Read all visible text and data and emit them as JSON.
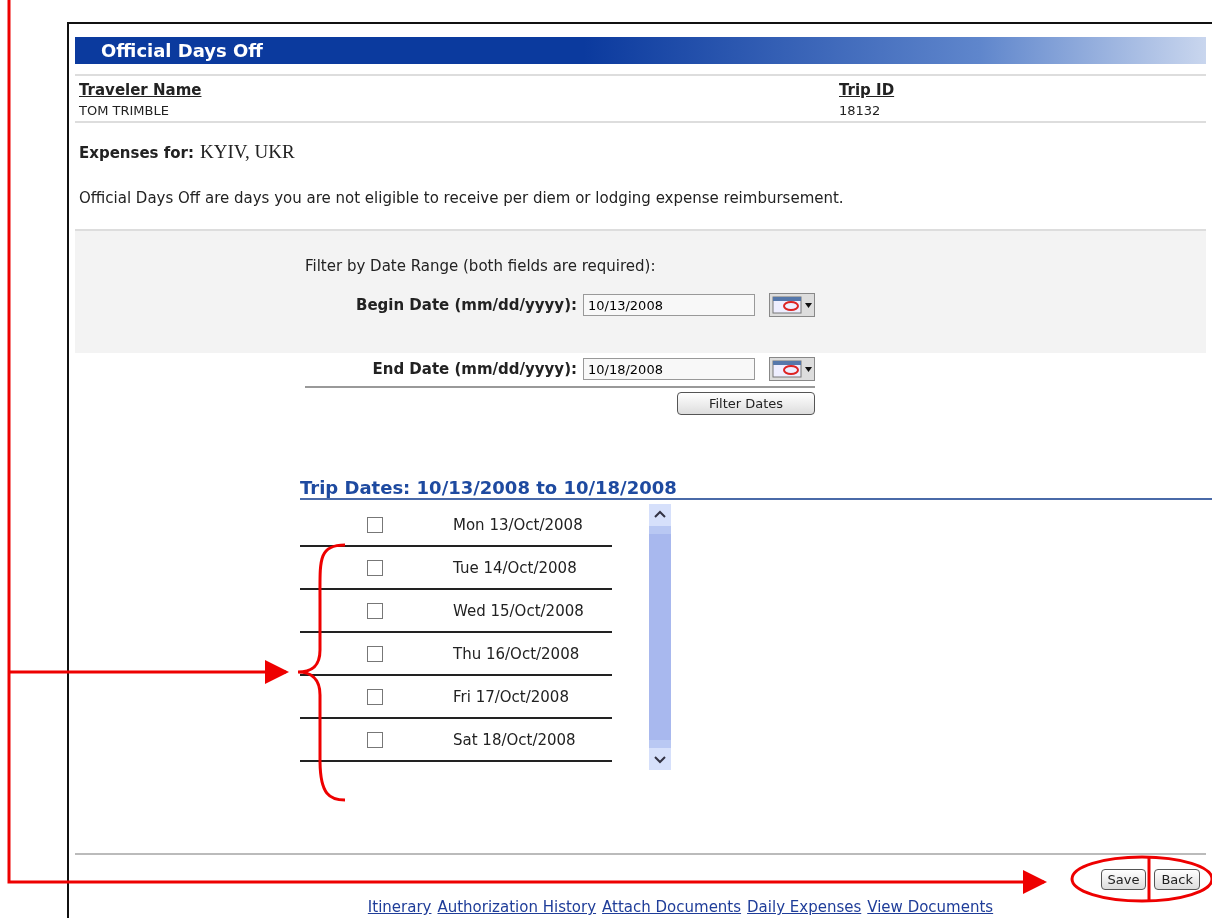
{
  "panel": {
    "title": "Official Days Off"
  },
  "traveler": {
    "label": "Traveler Name",
    "value": "TOM TRIMBLE"
  },
  "trip": {
    "label": "Trip ID",
    "value": "18132"
  },
  "expenses": {
    "label": "Expenses for:",
    "value": "KYIV, UKR"
  },
  "note": "Official Days Off are days you are not eligible to receive per diem or lodging expense reimbursement.",
  "filter": {
    "heading": "Filter by Date Range (both fields are required):",
    "fields": [
      {
        "label": "Begin Date (mm/dd/yyyy):",
        "value": "10/13/2008"
      },
      {
        "label": "End Date (mm/dd/yyyy):",
        "value": "10/18/2008"
      }
    ],
    "button": "Filter Dates"
  },
  "trip_dates": {
    "heading": "Trip Dates: 10/13/2008 to 10/18/2008",
    "rows": [
      {
        "date": "Mon 13/Oct/2008",
        "checked": false
      },
      {
        "date": "Tue 14/Oct/2008",
        "checked": false
      },
      {
        "date": "Wed 15/Oct/2008",
        "checked": false
      },
      {
        "date": "Thu 16/Oct/2008",
        "checked": false
      },
      {
        "date": "Fri 17/Oct/2008",
        "checked": false
      },
      {
        "date": "Sat 18/Oct/2008",
        "checked": false
      }
    ]
  },
  "buttons": [
    "Save",
    "Back"
  ],
  "footer_links": [
    "Itinerary",
    "Authorization History",
    "Attach Documents",
    "Daily Expenses",
    "View Documents"
  ]
}
